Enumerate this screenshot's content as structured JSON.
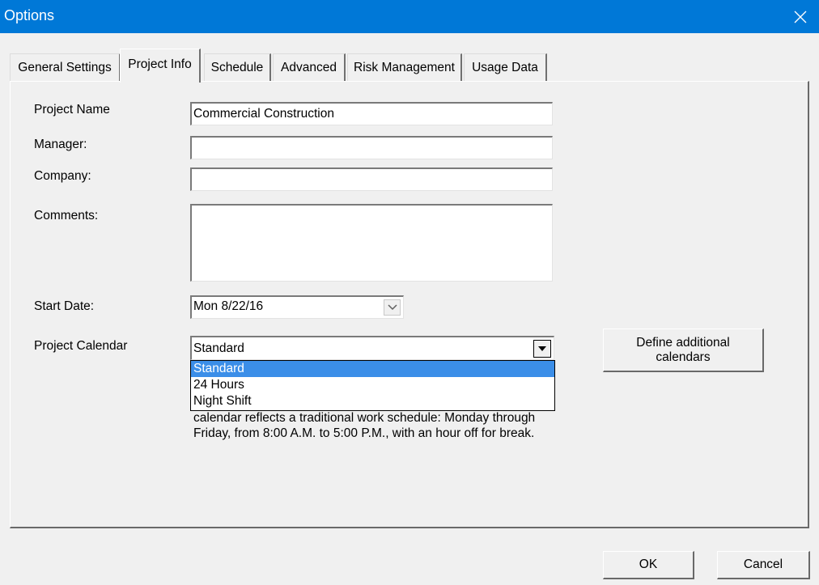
{
  "window": {
    "title": "Options"
  },
  "tabs": [
    {
      "label": "General Settings"
    },
    {
      "label": "Project Info"
    },
    {
      "label": "Schedule"
    },
    {
      "label": "Advanced"
    },
    {
      "label": "Risk Management"
    },
    {
      "label": "Usage Data"
    }
  ],
  "active_tab": "Project Info",
  "form": {
    "project_name_label": "Project Name",
    "project_name_value": "Commercial Construction",
    "manager_label": "Manager:",
    "manager_value": "",
    "company_label": "Company:",
    "company_value": "",
    "comments_label": "Comments:",
    "comments_value": "",
    "start_date_label": "Start Date:",
    "start_date_value": "Mon 8/22/16",
    "project_calendar_label": "Project Calendar",
    "project_calendar_value": "Standard",
    "calendar_options": [
      "Standard",
      "24 Hours",
      "Night Shift"
    ],
    "calendar_selected_option": "Standard",
    "calendar_description": "calendar reflects a traditional work schedule: Monday through Friday, from 8:00 A.M. to 5:00 P.M., with an hour off for break.",
    "define_calendars_label": "Define additional calendars"
  },
  "footer": {
    "ok_label": "OK",
    "cancel_label": "Cancel"
  },
  "colors": {
    "titlebar": "#0078d7",
    "dialog_bg": "#f0f0f0",
    "selection": "#3b8ee8"
  },
  "icons": {
    "close": "close-icon",
    "date_dropdown": "chevron-down-icon",
    "combo_dropdown": "triangle-down-icon"
  }
}
